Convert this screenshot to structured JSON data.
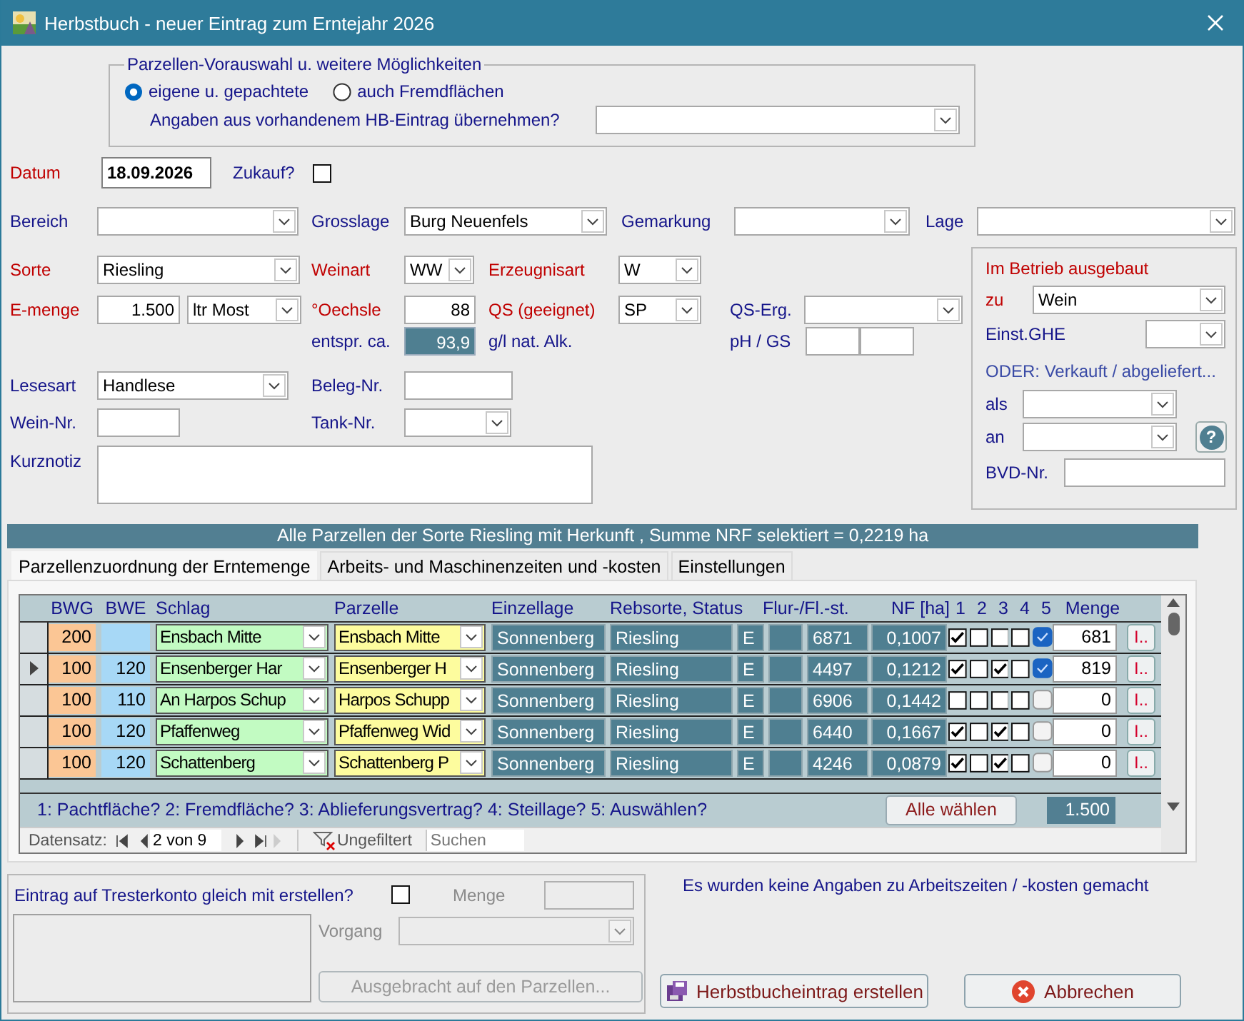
{
  "window": {
    "title": "Herbstbuch - neuer Eintrag zum Erntejahr 2026"
  },
  "preselection": {
    "legend": "Parzellen-Vorauswahl u. weitere Möglichkeiten",
    "options": [
      {
        "label": "eigene u. gepachtete",
        "selected": true
      },
      {
        "label": "auch Fremdflächen",
        "selected": false
      }
    ],
    "copy_label": "Angaben aus vorhandenem HB-Eintrag übernehmen?"
  },
  "form": {
    "datum": {
      "label": "Datum",
      "required": true,
      "value": "18.09.2026"
    },
    "zukauf": {
      "label": "Zukauf?",
      "required": false,
      "checked": false
    },
    "bereich": {
      "label": "Bereich",
      "required": false
    },
    "grosslage": {
      "label": "Grosslage",
      "required": false,
      "value": "Burg Neuenfels"
    },
    "gemarkung": {
      "label": "Gemarkung",
      "required": false
    },
    "lage": {
      "label": "Lage",
      "required": false
    },
    "sorte": {
      "label": "Sorte",
      "required": true,
      "value": "Riesling"
    },
    "weinart": {
      "label": "Weinart",
      "required": true,
      "value": "WW"
    },
    "erzeugnisart": {
      "label": "Erzeugnisart",
      "required": true,
      "value": "W"
    },
    "emenge": {
      "label": "E-menge",
      "required": true,
      "value": "1.500",
      "unit": "ltr Most"
    },
    "oechsle": {
      "label": "°Oechsle",
      "required": true,
      "value": "88"
    },
    "qs": {
      "label": "QS (geeignet)",
      "required": true,
      "value": "SP"
    },
    "qs_erg": {
      "label": "QS-Erg.",
      "required": false
    },
    "alkohol": {
      "label": "entspr. ca.",
      "required": false,
      "value": "93,9",
      "unit": "g/l nat. Alk."
    },
    "ph_gs": {
      "label": "pH / GS",
      "required": false
    },
    "lesesart": {
      "label": "Lesesart",
      "required": false,
      "value": "Handlese"
    },
    "beleg_nr": {
      "label": "Beleg-Nr.",
      "required": false
    },
    "wein_nr": {
      "label": "Wein-Nr.",
      "required": false
    },
    "tank_nr": {
      "label": "Tank-Nr.",
      "required": false
    },
    "kurznotiz": {
      "label": "Kurznotiz",
      "required": false
    }
  },
  "ausbau": {
    "title": "Im Betrieb ausgebaut",
    "zu": {
      "label": "zu",
      "required": true,
      "value": "Wein"
    },
    "einst_ghe": {
      "label": "Einst.GHE",
      "required": false
    },
    "oder": "ODER: Verkauft / abgeliefert...",
    "als": {
      "label": "als",
      "required": false
    },
    "an": {
      "label": "an",
      "required": false
    },
    "help": "?",
    "bvd_nr": {
      "label": "BVD-Nr.",
      "required": false
    }
  },
  "banner": "Alle Parzellen der Sorte Riesling mit Herkunft , Summe NRF selektiert = 0,2219 ha",
  "tabs": [
    {
      "label": "Parzellenzuordnung der Erntemenge",
      "selected": true
    },
    {
      "label": "Arbeits- und Maschinenzeiten und -kosten",
      "selected": false
    },
    {
      "label": "Einstellungen",
      "selected": false
    }
  ],
  "table": {
    "columns": [
      "BWG",
      "BWE",
      "Schlag",
      "Parzelle",
      "Einzellage",
      "Rebsorte, Status",
      "Flur-/Fl.-st.",
      "NF [ha]",
      "1",
      "2",
      "3",
      "4",
      "5",
      "Menge"
    ],
    "rows": [
      {
        "current": false,
        "bwg": "200",
        "schlag": "Ensbach Mitte",
        "parzelle": "Ensbach Mitte",
        "einzellage": "Sonnenberg",
        "rebsorte": "Riesling",
        "status": "E",
        "flur": "6871",
        "nf": "0,1007",
        "flags": [
          true,
          false,
          false,
          false
        ],
        "selected": true,
        "menge": "681",
        "detail": "I.."
      },
      {
        "current": true,
        "bwg": "100",
        "bwe": "120",
        "schlag": "Ensenberger Har",
        "parzelle": "Ensenberger H",
        "einzellage": "Sonnenberg",
        "rebsorte": "Riesling",
        "status": "E",
        "flur": "4497",
        "nf": "0,1212",
        "flags": [
          true,
          false,
          true,
          false
        ],
        "selected": true,
        "menge": "819",
        "detail": "I.."
      },
      {
        "current": false,
        "bwg": "100",
        "bwe": "110",
        "schlag": "An Harpos Schup",
        "parzelle": "Harpos Schupp",
        "einzellage": "Sonnenberg",
        "rebsorte": "Riesling",
        "status": "E",
        "flur": "6906",
        "nf": "0,1442",
        "flags": [
          false,
          false,
          false,
          false
        ],
        "selected": false,
        "menge": "0",
        "detail": "I.."
      },
      {
        "current": false,
        "bwg": "100",
        "bwe": "120",
        "schlag": "Pfaffenweg",
        "parzelle": "Pfaffenweg Wid",
        "einzellage": "Sonnenberg",
        "rebsorte": "Riesling",
        "status": "E",
        "flur": "6440",
        "nf": "0,1667",
        "flags": [
          true,
          false,
          true,
          false
        ],
        "selected": false,
        "menge": "0",
        "detail": "I.."
      },
      {
        "current": false,
        "bwg": "100",
        "bwe": "120",
        "schlag": "Schattenberg",
        "parzelle": "Schattenberg P",
        "einzellage": "Sonnenberg",
        "rebsorte": "Riesling",
        "status": "E",
        "flur": "4246",
        "nf": "0,0879",
        "flags": [
          true,
          false,
          true,
          false
        ],
        "selected": false,
        "menge": "0",
        "detail": "I.."
      }
    ],
    "legend": "1: Pachtfläche? 2: Fremdfläche? 3: Ablieferungsvertrag? 4: Steillage? 5: Auswählen?",
    "select_all": "Alle wählen",
    "total": "1.500"
  },
  "navigator": {
    "label": "Datensatz:",
    "position": "2 von 9",
    "filter": "Ungefiltert",
    "search_placeholder": "Suchen"
  },
  "trester": {
    "label": "Eintrag auf Tresterkonto gleich mit erstellen?",
    "checked": false,
    "menge_label": "Menge",
    "vorgang_label": "Vorgang",
    "button": "Ausgebracht auf den Parzellen...",
    "disabled": true
  },
  "note": "Es wurden keine Angaben zu Arbeitszeiten / -kosten gemacht",
  "buttons": [
    {
      "label": "Herbstbucheintrag erstellen",
      "kind": "save"
    },
    {
      "label": "Abbrechen",
      "kind": "cancel"
    }
  ]
}
